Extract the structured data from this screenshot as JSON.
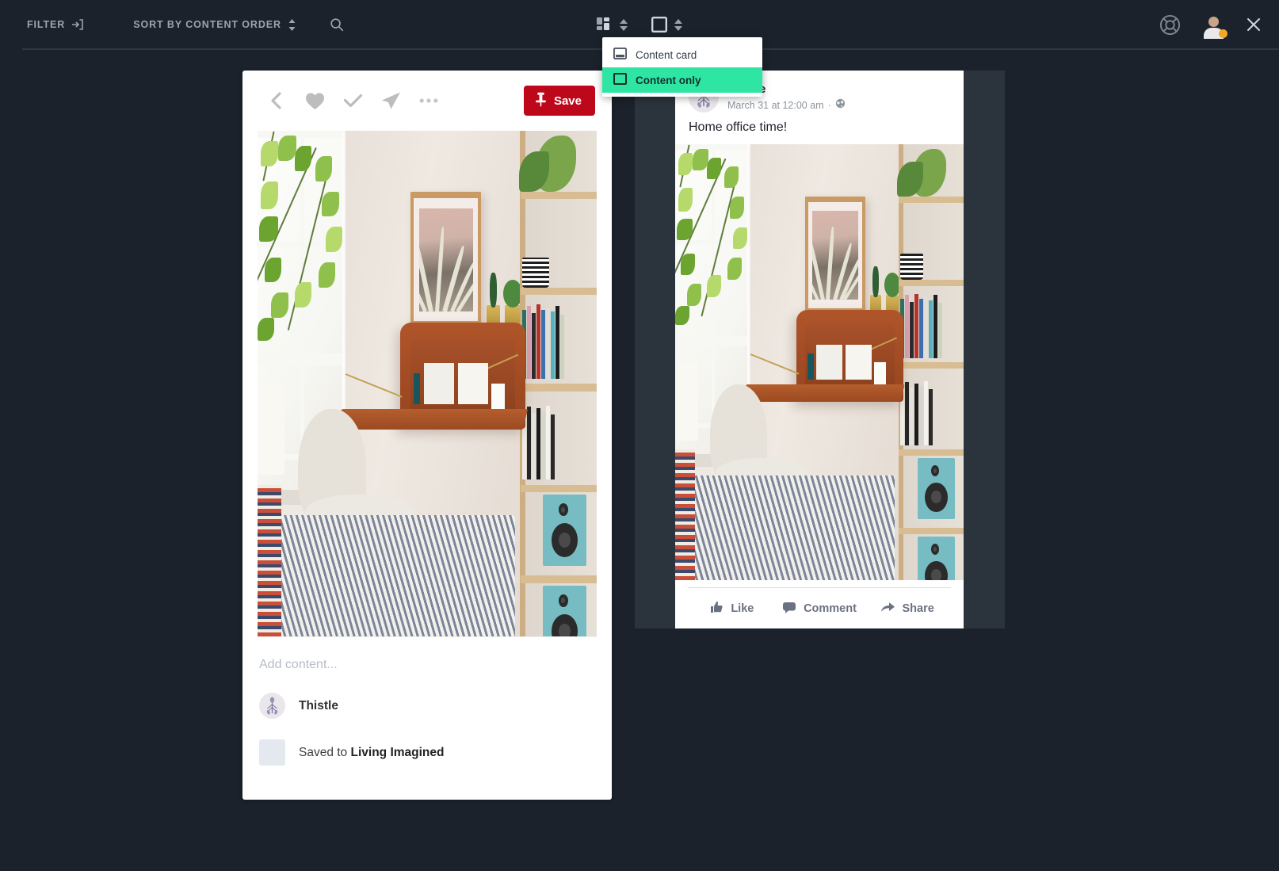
{
  "window": {
    "background": "#1b222b",
    "panel": "#2b333c"
  },
  "toolbar": {
    "filter_label": "FILTER",
    "filter_icon": "login-arrow-icon",
    "sort_label": "SORT BY CONTENT ORDER",
    "sort_icon": "sort-updown-icon",
    "search_icon": "search-icon",
    "layout_icon": "grid-layout-icon",
    "layout_caret_icon": "caret-updown-icon",
    "viewmode_icon": "square-outline-icon",
    "viewmode_caret_icon": "caret-updown-icon",
    "help_icon": "lifebuoy-icon",
    "avatar_icon": "user-avatar",
    "close_icon": "close-x-icon"
  },
  "dropdown": {
    "items": [
      {
        "label": "Content card",
        "icon": "content-card-icon",
        "selected": false
      },
      {
        "label": "Content only",
        "icon": "content-only-icon",
        "selected": true
      }
    ],
    "highlight_color": "#2ee5a4"
  },
  "pin_card": {
    "tools": [
      {
        "name": "back-icon",
        "glyph": "chevron-left"
      },
      {
        "name": "heart-icon",
        "glyph": "heart"
      },
      {
        "name": "check-icon",
        "glyph": "check"
      },
      {
        "name": "send-icon",
        "glyph": "paper-plane"
      },
      {
        "name": "more-icon",
        "glyph": "ellipsis"
      }
    ],
    "save_label": "Save",
    "save_icon": "pin-icon",
    "save_color": "#bd081c",
    "add_content_placeholder": "Add content...",
    "user_name": "Thistle",
    "saved_to_prefix": "Saved to ",
    "board_name": "Living Imagined",
    "photo_alt": "Wall-mounted wooden fold-down desk with white Eames chair, bookshelf, plants and teal speakers"
  },
  "fb_card": {
    "author": "Thistle",
    "timestamp": "March 31 at 12:00 am",
    "privacy_icon": "globe-icon",
    "meta_separator": "·",
    "message": "Home office time!",
    "actions": [
      {
        "label": "Like",
        "icon": "thumbs-up-icon"
      },
      {
        "label": "Comment",
        "icon": "comment-bubble-icon"
      },
      {
        "label": "Share",
        "icon": "share-arrow-icon"
      }
    ],
    "photo_alt": "Wall-mounted wooden fold-down desk with white Eames chair, bookshelf, plants and teal speakers"
  }
}
